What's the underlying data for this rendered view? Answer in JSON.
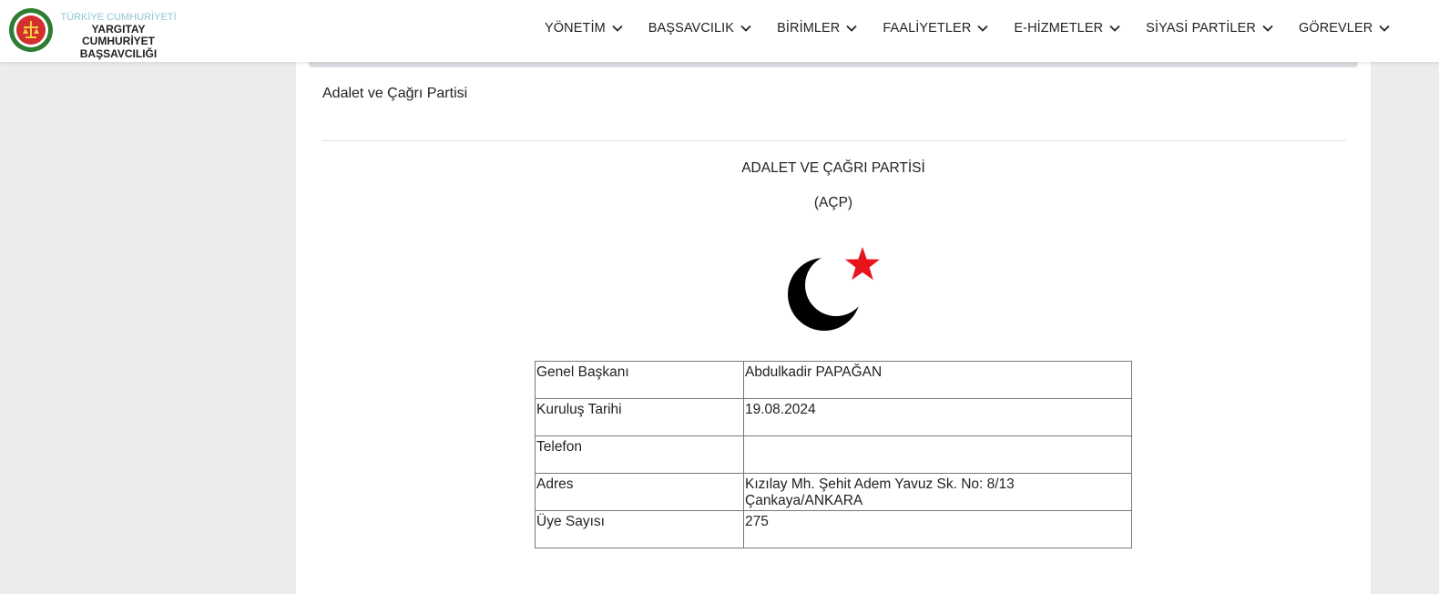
{
  "brand": {
    "line1": "TÜRKİYE CUMHURİYETİ",
    "line2": "YARGITAY CUMHURİYET",
    "line3": "BAŞSAVCILIĞI",
    "logo_icon": "yargitay-seal-icon",
    "logo_color": "#2e7d32"
  },
  "nav": [
    {
      "label": "YÖNETİM"
    },
    {
      "label": "BAŞSAVCILIK"
    },
    {
      "label": "BİRİMLER"
    },
    {
      "label": "FAALİYETLER"
    },
    {
      "label": "E-HİZMETLER"
    },
    {
      "label": "SİYASİ PARTİLER"
    },
    {
      "label": "GÖREVLER"
    }
  ],
  "page": {
    "title": "Adalet ve Çağrı Partisi"
  },
  "party": {
    "name": "ADALET VE ÇAĞRI PARTİSİ",
    "abbr": "(AÇP)",
    "emblem_icon": "crescent-star-icon",
    "star_color": "#e8141c"
  },
  "info_table": [
    {
      "key": "Genel Başkanı",
      "value": "Abdulkadir PAPAĞAN"
    },
    {
      "key": "Kuruluş Tarihi",
      "value": "19.08.2024"
    },
    {
      "key": "Telefon",
      "value": ""
    },
    {
      "key": "Adres",
      "value": "Kızılay Mh. Şehit Adem Yavuz Sk. No: 8/13 Çankaya/ANKARA"
    },
    {
      "key": "Üye Sayısı",
      "value": "275"
    }
  ]
}
